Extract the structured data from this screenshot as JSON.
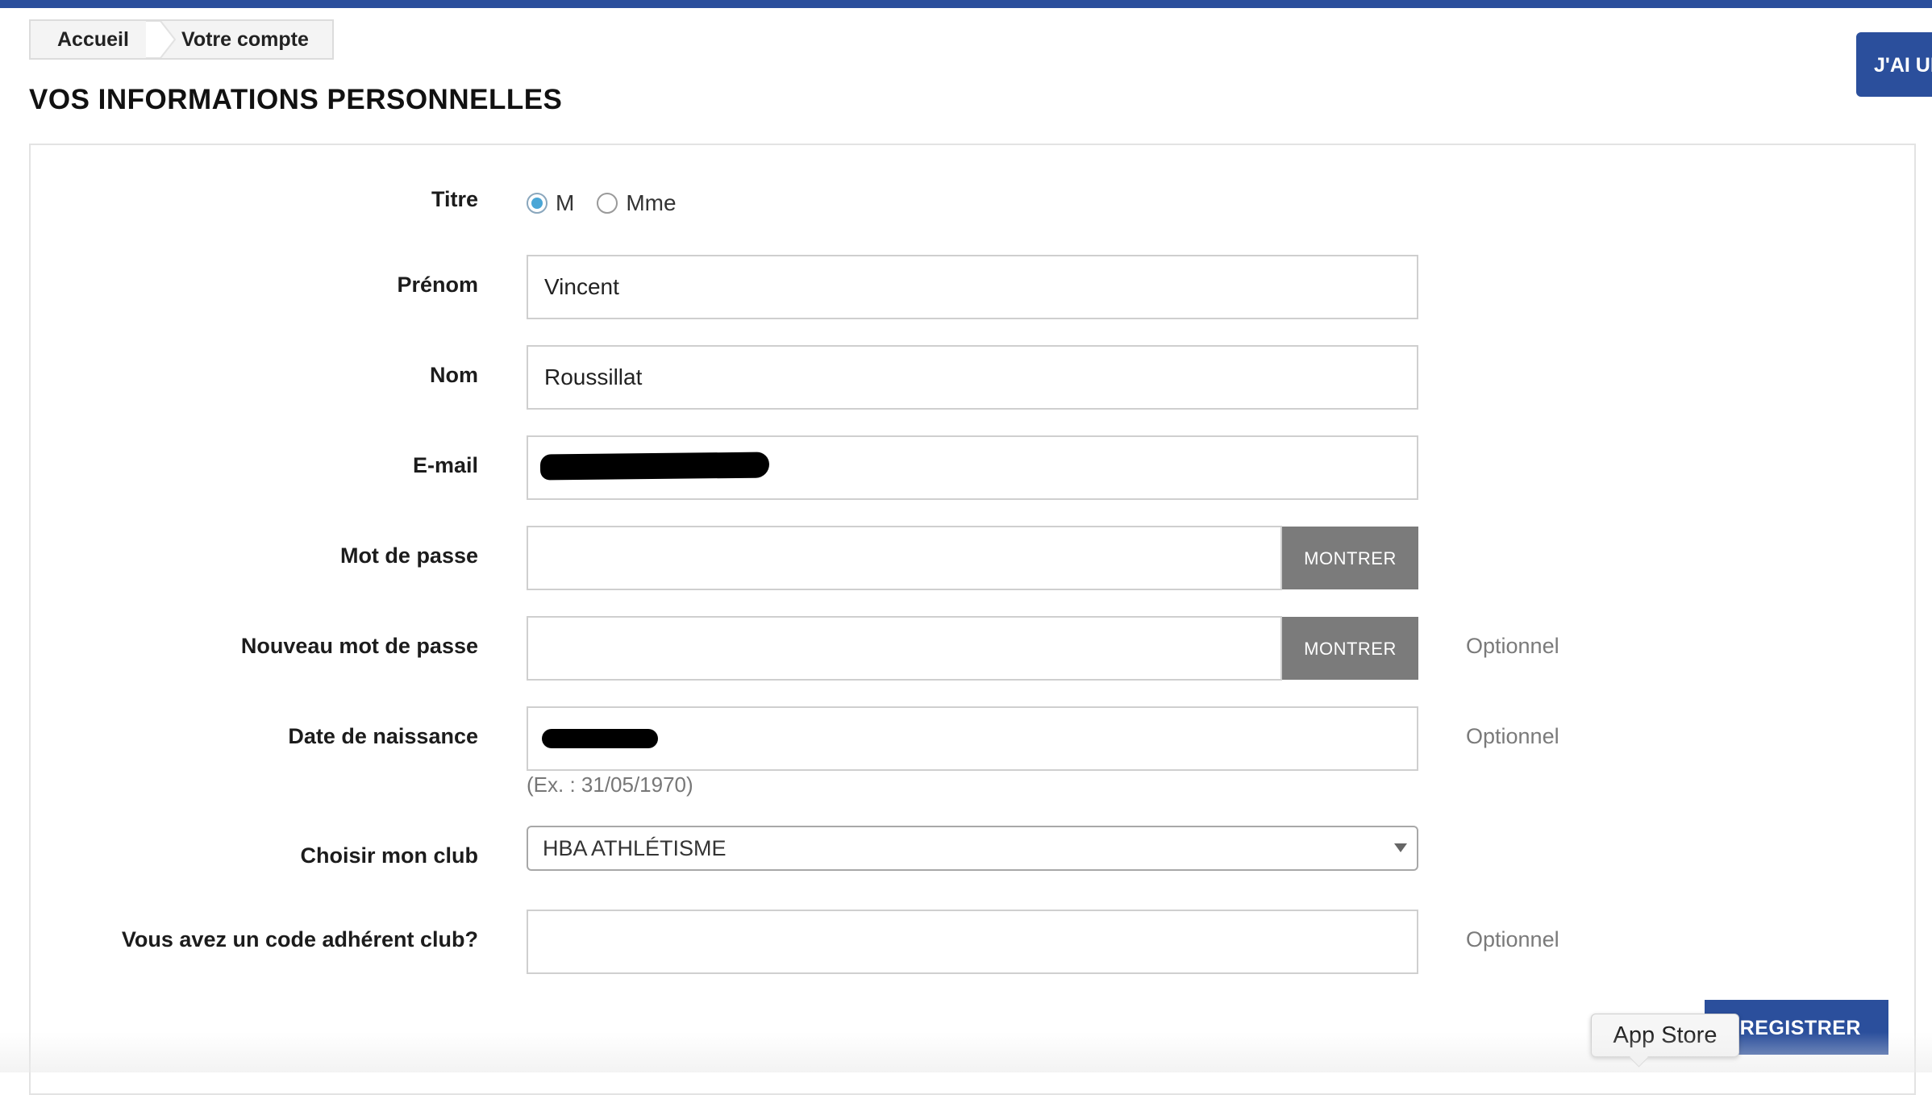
{
  "breadcrumb": {
    "home": "Accueil",
    "current": "Votre compte"
  },
  "page_title": "VOS INFORMATIONS PERSONNELLES",
  "top_right_button": "J'AI UN",
  "form": {
    "titre": {
      "label": "Titre",
      "options": [
        "M",
        "Mme"
      ],
      "selected": "M"
    },
    "prenom": {
      "label": "Prénom",
      "value": "Vincent"
    },
    "nom": {
      "label": "Nom",
      "value": "Roussillat"
    },
    "email": {
      "label": "E-mail",
      "value": ""
    },
    "password": {
      "label": "Mot de passe",
      "value": "",
      "show_button": "MONTRER"
    },
    "new_password": {
      "label": "Nouveau mot de passe",
      "value": "",
      "show_button": "MONTRER",
      "optional": "Optionnel"
    },
    "birthdate": {
      "label": "Date de naissance",
      "value": "",
      "hint": "(Ex. : 31/05/1970)",
      "optional": "Optionnel"
    },
    "club": {
      "label": "Choisir mon club",
      "selected": "HBA ATHLÉTISME"
    },
    "member_code": {
      "label": "Vous avez un code adhérent club?",
      "value": "",
      "optional": "Optionnel"
    }
  },
  "save_button": "ENREGISTRER",
  "tooltip": "App Store",
  "colors": {
    "brand_blue": "#2b4f9c",
    "show_button_gray": "#7b7b7b",
    "radio_checked": "#4aa6d6"
  }
}
